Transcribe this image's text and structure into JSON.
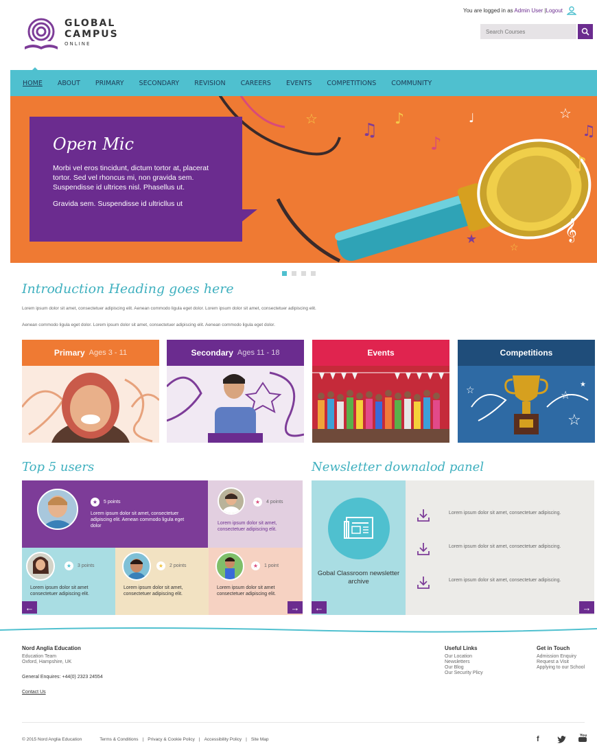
{
  "header": {
    "logo": {
      "line1": "GLOBAL",
      "line2": "CAMPUS",
      "line3": "ONLINE"
    },
    "login_prefix": "You are logged in as ",
    "login_user": "Admin User",
    "login_logout": "Logout",
    "search_placeholder": "Search Courses"
  },
  "nav": {
    "items": [
      "HOME",
      "ABOUT",
      "PRIMARY",
      "SECONDARY",
      "REVISION",
      "CAREERS",
      "EVENTS",
      "COMPETITIONS",
      "COMMUNITY"
    ],
    "active": "HOME"
  },
  "hero": {
    "title": "Open Mic",
    "body1": "Morbi vel eros tincidunt, dictum tortor at, placerat tortor. Sed vel rhoncus mi, non gravida sem. Suspendisse id ultrices nisl. Phasellus ut.",
    "body2": "Gravida sem. Suspendisse id ultricllus ut",
    "slides": 4,
    "active_slide": 1
  },
  "intro": {
    "heading": "Introduction Heading goes here",
    "p1": "Lorem ipsum dolor sit amet, consectetuer adipiscing elit. Aenean commodo ligula eget dolor. Lorem ipsum dolor sit amet, consectetuer adipiscing elit.",
    "p2": "Aenean commodo ligula eget dolor. Lorem ipsum dolor sit amet, consectetuer adipiscing elit. Aenean commodo ligula eget dolor."
  },
  "cards": [
    {
      "title": "Primary",
      "sub": "Ages 3 - 11",
      "color": "#ef7a33"
    },
    {
      "title": "Secondary",
      "sub": "Ages 11 - 18",
      "color": "#6b2c8f"
    },
    {
      "title": "Events",
      "sub": "",
      "color": "#e0244f"
    },
    {
      "title": "Competitions",
      "sub": "",
      "color": "#1f4d7a"
    }
  ],
  "top_users": {
    "heading": "Top 5 users",
    "users": [
      {
        "points": "5 points",
        "text": "Lorem ipsum dolor sit amet, consectetuer adipiscing elit. Aenean commodo ligula eget dolor"
      },
      {
        "points": "4 points",
        "text": "Lorem ipsum dolor sit amet, consectetuer adipiscing elit."
      },
      {
        "points": "3 points",
        "text": "Lorem ipsum dolor sit amet consectetuer adipiscing elit."
      },
      {
        "points": "2 points",
        "text": "Lorem ipsum dolor sit amet, consectetuer adipiscing elit."
      },
      {
        "points": "1 point",
        "text": "Lorem ipsum dolor sit amet consectetuer adipiscing elit."
      }
    ],
    "colors": {
      "purple": "#7d3c98",
      "lilac": "#e2cfe0",
      "teal": "#a9dde3",
      "sand": "#f2e2c2",
      "peach": "#f6d2c2"
    }
  },
  "newsletter": {
    "heading": "Newsletter downalod panel",
    "caption": "Gobal Classroom newsletter archive",
    "items": [
      "Lorem ipsum dolor sit amet, consectetuer adipiscing.",
      "Lorem ipsum dolor sit amet, consectetuer adipiscing.",
      "Lorem ipsum dolor sit amet, consectetuer adipiscing."
    ]
  },
  "footer": {
    "org": "Nord Anglia Education",
    "addr1": "Education Team",
    "addr2": "Oxford, Hampshire, UK",
    "enquiries": "General Enquires: +44(0) 2323 24554",
    "contact": "Contact Us",
    "useful_title": "Useful Links",
    "useful": [
      "Our Location",
      "Newsletters",
      "Our Blog",
      "Our Security Plicy"
    ],
    "touch_title": "Get in Touch",
    "touch": [
      "Admission Enquiry",
      "Request a Visit",
      "Applying to our School"
    ],
    "copyright": "© 2015 Nord Anglia Education",
    "bottom_links": [
      "Terms & Conditions",
      "Privacy & Cookie Policy",
      "Accessibility Policy",
      "Site Map"
    ],
    "social": [
      "facebook",
      "twitter",
      "youtube"
    ]
  }
}
